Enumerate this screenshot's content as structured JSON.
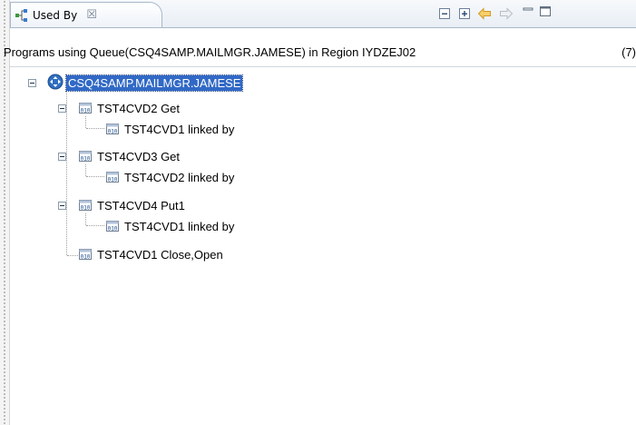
{
  "view": {
    "tab_label": "Used By",
    "tab_close_glyph": "☒",
    "toolbar_icons": [
      "collapse-all-icon",
      "expand-all-icon",
      "back-arrow-icon",
      "forward-arrow-icon",
      "minimize-icon",
      "maximize-icon"
    ]
  },
  "info": {
    "text": "Programs using Queue(CSQ4SAMP.MAILMGR.JAMESE) in Region IYDZEJ02",
    "count": "(7)"
  },
  "tree": {
    "root": {
      "label": "CSQ4SAMP.MAILMGR.JAMESE",
      "icon": "queue-icon"
    },
    "items": [
      {
        "label": "TST4CVD2  Get",
        "child": "TST4CVD1  linked by"
      },
      {
        "label": "TST4CVD3  Get",
        "child": "TST4CVD2  linked by"
      },
      {
        "label": "TST4CVD4  Put1",
        "child": "TST4CVD1  linked by"
      },
      {
        "label": "TST4CVD1  Close,Open"
      }
    ]
  },
  "colors": {
    "selection": "#3169c6",
    "tab_border": "#a9b8c9",
    "arrow_active": "#f0b13a"
  }
}
